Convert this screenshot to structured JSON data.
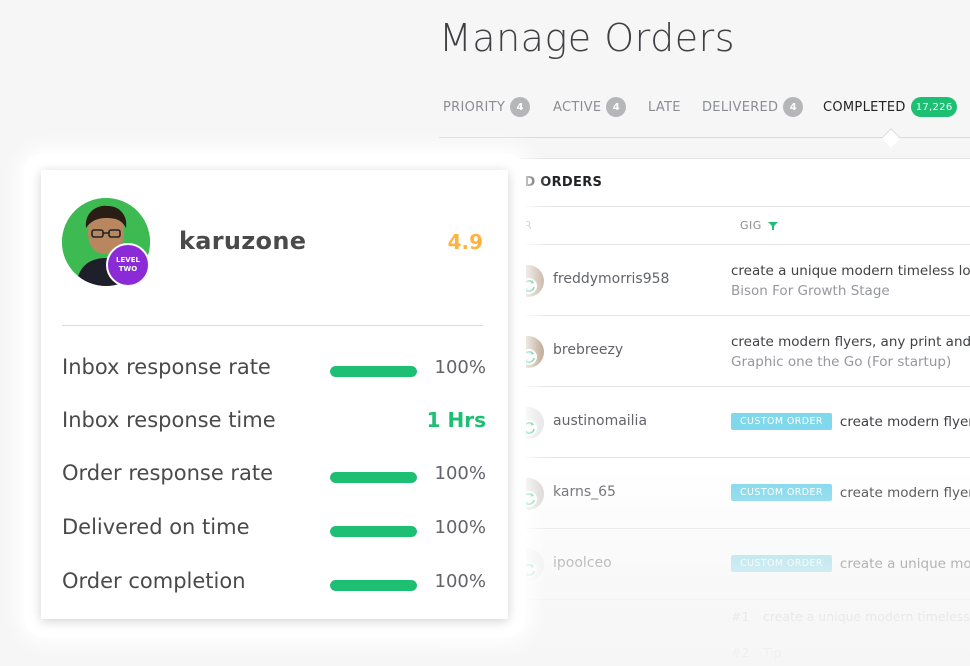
{
  "page": {
    "title": "Manage Orders"
  },
  "tabs": [
    {
      "label": "PRIORITY",
      "count": "4",
      "active": false
    },
    {
      "label": "ACTIVE",
      "count": "4",
      "active": false
    },
    {
      "label": "LATE",
      "count": "",
      "active": false
    },
    {
      "label": "DELIVERED",
      "count": "4",
      "active": false
    },
    {
      "label": "COMPLETED",
      "count": "17,226",
      "active": true
    }
  ],
  "orders": {
    "panel_title": "TED ORDERS",
    "columns": {
      "buyer": "R",
      "gig": "GIG"
    },
    "rows": [
      {
        "buyer": "freddymorris958",
        "type": "normal",
        "gig_title": "create a unique modern timeless logo",
        "gig_sub": "Bison For Growth Stage"
      },
      {
        "buyer": "brebreezy",
        "type": "normal",
        "gig_title": "create modern flyers, any print and g",
        "gig_sub": "Graphic one the Go (For startup)"
      },
      {
        "buyer": "austinomailia",
        "type": "custom",
        "badge": "CUSTOM ORDER",
        "gig_title": "create modern flyers"
      },
      {
        "buyer": "karns_65",
        "type": "custom",
        "badge": "CUSTOM ORDER",
        "gig_title": "create modern flyers"
      },
      {
        "buyer": "ipoolceo",
        "type": "custom",
        "badge": "CUSTOM ORDER",
        "gig_title": "create a unique mod"
      }
    ],
    "extra_lines": [
      {
        "num": "#1",
        "text": "create a unique modern timeless lo"
      },
      {
        "num": "#2",
        "text": "Tip"
      }
    ]
  },
  "seller": {
    "username": "karuzone",
    "rating": "4.9",
    "level_badge": {
      "line1": "LEVEL",
      "line2": "TWO"
    },
    "stats": [
      {
        "label": "Inbox response rate",
        "value": "100%",
        "progress": 1.0,
        "bar": true
      },
      {
        "label": "Inbox response time",
        "value": "1 Hrs",
        "bar": false
      },
      {
        "label": "Order response rate",
        "value": "100%",
        "progress": 1.0,
        "bar": true
      },
      {
        "label": "Delivered on time",
        "value": "100%",
        "progress": 1.0,
        "bar": true
      },
      {
        "label": "Order completion",
        "value": "100%",
        "progress": 1.0,
        "bar": true
      }
    ]
  },
  "colors": {
    "accent_green": "#1dbf73",
    "rating_orange": "#ffb33e",
    "level_purple": "#8b2ad7",
    "custom_badge": "#7fd8ec"
  },
  "icons": {
    "filter": "filter-icon",
    "swap": "swap-arrows-icon"
  }
}
